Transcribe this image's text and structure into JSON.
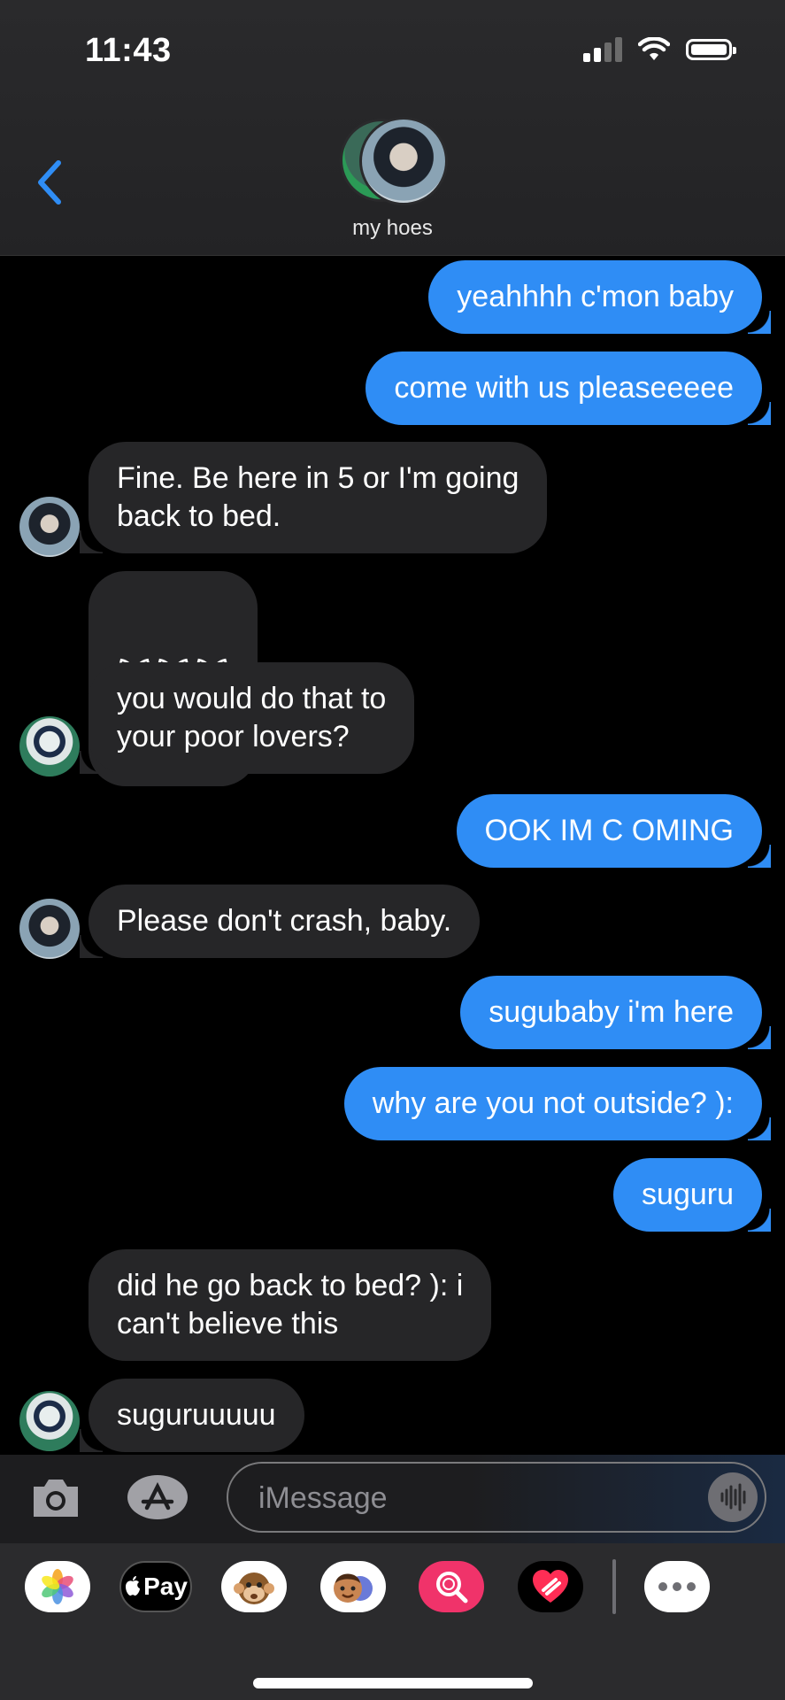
{
  "status_bar": {
    "time": "11:43"
  },
  "header": {
    "group_name": "my hoes"
  },
  "messages": [
    {
      "dir": "out",
      "text": "yeahhhh c'mon baby"
    },
    {
      "dir": "out",
      "text": "come with us pleaseeeee"
    },
    {
      "dir": "in",
      "sender": "suguru",
      "text": "Fine. Be here in 5 or I'm going\nback to bed."
    },
    {
      "dir": "in",
      "sender": "satoru",
      "text": "🙀🙀🙀"
    },
    {
      "dir": "in",
      "sender": "satoru",
      "text": "you would do that to\nyour poor lovers?"
    },
    {
      "dir": "out",
      "text": "OOK IM C OMING"
    },
    {
      "dir": "in",
      "sender": "suguru",
      "text": "Please don't crash, baby."
    },
    {
      "dir": "out",
      "text": "sugubaby i'm here"
    },
    {
      "dir": "out",
      "text": "why are you not outside? ):"
    },
    {
      "dir": "out",
      "text": "suguru"
    },
    {
      "dir": "in",
      "sender": "satoru",
      "text": "did he go back to bed? ): i\ncan't believe this"
    },
    {
      "dir": "in",
      "sender": "satoru",
      "text": "suguruuuuu"
    }
  ],
  "input": {
    "placeholder": "iMessage"
  },
  "tray": {
    "apple_pay_label": "Pay"
  },
  "icons": [
    "back-chevron-icon",
    "camera-icon",
    "app-store-icon",
    "audio-message-icon",
    "photos-icon",
    "apple-pay-icon",
    "memoji-monkey-icon",
    "memoji-icon",
    "image-search-icon",
    "digital-touch-icon",
    "more-icon"
  ],
  "colors": {
    "outgoing": "#2f8df5",
    "incoming": "#262628",
    "background": "#000000",
    "accent": "#2f8df5"
  }
}
